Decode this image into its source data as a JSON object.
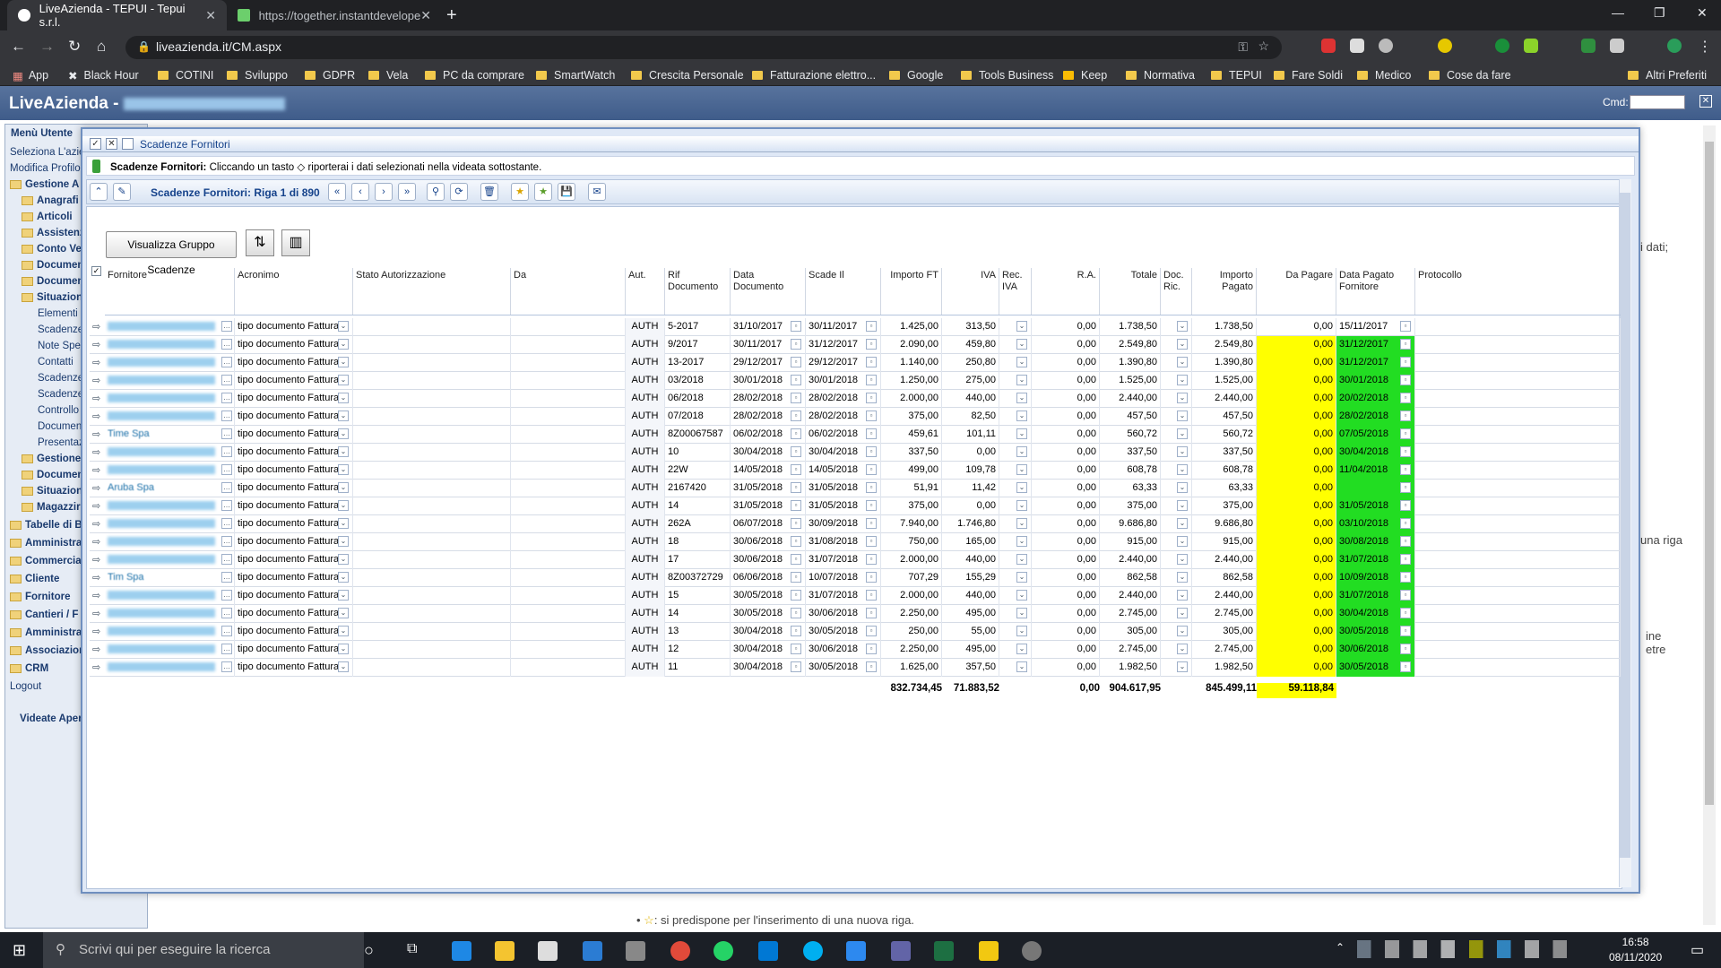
{
  "browser": {
    "tabs": [
      {
        "title": "LiveAzienda - TEPUI - Tepui s.r.l."
      },
      {
        "title": "https://together.instantdevelope"
      }
    ],
    "url": "liveazienda.it/CM.aspx",
    "bookmarks": [
      "App",
      "Black Hour",
      "COTINI",
      "Sviluppo",
      "GDPR",
      "Vela",
      "PC da comprare",
      "SmartWatch",
      "Crescita Personale",
      "Fatturazione elettro...",
      "Google",
      "Tools Business",
      "Keep",
      "Normativa",
      "TEPUI",
      "Fare Soldi",
      "Medico",
      "Cose da fare",
      "Altri Preferiti"
    ]
  },
  "app": {
    "title": "LiveAzienda -",
    "cmd_label": "Cmd:",
    "menu": {
      "header": "Menù Utente",
      "items": [
        "Seleziona L'azie",
        "Modifica Profilo",
        "Gestione A",
        "Anagrafi",
        "Articoli",
        "Assistenz",
        "Conto Ve",
        "Documen",
        "Documen",
        "Situazion",
        "Elementi",
        "Scadenze",
        "Note Spes",
        "Contatti",
        "Scadenze",
        "Scadenze",
        "Controllo",
        "Documen",
        "Presentaz",
        "Gestione",
        "Documen",
        "Situazion",
        "Magazzir",
        "Tabelle di B",
        "Amministra",
        "Commercial",
        "Cliente",
        "Fornitore",
        "Cantieri / F",
        "Amministra",
        "Associazion",
        "CRM",
        "Logout"
      ],
      "footer": "Videate Aper"
    },
    "bg_text": [
      "i dati;",
      "una riga",
      "ine",
      "etre",
      ": si predispone per l'inserimento di una nuova riga."
    ]
  },
  "dialog": {
    "title": "Scadenze Fornitori",
    "info_bold": "Scadenze Fornitori:",
    "info_text": "Cliccando un tasto",
    "info_text2": "riporterai i dati selezionati nella videata sottostante.",
    "nav_title": "Scadenze Fornitori: Riga 1 di 890",
    "group_button": "Visualizza Gruppo Scadenze",
    "columns": [
      "Fornitore",
      "Acronimo",
      "Stato Autorizzazione",
      "Da",
      "Aut.",
      "Rif Documento",
      "Data Documento",
      "Scade Il",
      "Importo FT",
      "IVA",
      "Rec. IVA",
      "R.A.",
      "Totale",
      "Doc. Ric.",
      "Importo Pagato",
      "Da Pagare",
      "Data Pagato Fornitore",
      "Protocollo"
    ],
    "rows": [
      {
        "acr": "tipo documento Fattura",
        "aut": "AUTH",
        "rif": "5-2017",
        "dd": "31/10/2017",
        "sc": "30/11/2017",
        "imp": "1.425,00",
        "iva": "313,50",
        "ra": "0,00",
        "tot": "1.738,50",
        "pag": "1.738,50",
        "dap": "0,00",
        "dpf": "15/11/2017",
        "hl": false
      },
      {
        "acr": "tipo documento Fattura",
        "aut": "AUTH",
        "rif": "9/2017",
        "dd": "30/11/2017",
        "sc": "31/12/2017",
        "imp": "2.090,00",
        "iva": "459,80",
        "ra": "0,00",
        "tot": "2.549,80",
        "pag": "2.549,80",
        "dap": "0,00",
        "dpf": "31/12/2017",
        "hl": true
      },
      {
        "acr": "tipo documento Fattura",
        "aut": "AUTH",
        "rif": "13-2017",
        "dd": "29/12/2017",
        "sc": "29/12/2017",
        "imp": "1.140,00",
        "iva": "250,80",
        "ra": "0,00",
        "tot": "1.390,80",
        "pag": "1.390,80",
        "dap": "0,00",
        "dpf": "31/12/2017",
        "hl": true
      },
      {
        "acr": "tipo documento Fattura",
        "aut": "AUTH",
        "rif": "03/2018",
        "dd": "30/01/2018",
        "sc": "30/01/2018",
        "imp": "1.250,00",
        "iva": "275,00",
        "ra": "0,00",
        "tot": "1.525,00",
        "pag": "1.525,00",
        "dap": "0,00",
        "dpf": "30/01/2018",
        "hl": true
      },
      {
        "acr": "tipo documento Fattura",
        "aut": "AUTH",
        "rif": "06/2018",
        "dd": "28/02/2018",
        "sc": "28/02/2018",
        "imp": "2.000,00",
        "iva": "440,00",
        "ra": "0,00",
        "tot": "2.440,00",
        "pag": "2.440,00",
        "dap": "0,00",
        "dpf": "20/02/2018",
        "hl": true
      },
      {
        "acr": "tipo documento Fattura",
        "aut": "AUTH",
        "rif": "07/2018",
        "dd": "28/02/2018",
        "sc": "28/02/2018",
        "imp": "375,00",
        "iva": "82,50",
        "ra": "0,00",
        "tot": "457,50",
        "pag": "457,50",
        "dap": "0,00",
        "dpf": "28/02/2018",
        "hl": true
      },
      {
        "acr": "tipo documento Fattura",
        "aut": "AUTH",
        "rif": "8Z00067587",
        "dd": "06/02/2018",
        "sc": "06/02/2018",
        "imp": "459,61",
        "iva": "101,11",
        "ra": "0,00",
        "tot": "560,72",
        "pag": "560,72",
        "dap": "0,00",
        "dpf": "07/05/2018",
        "hl": true
      },
      {
        "acr": "tipo documento Fattura",
        "aut": "AUTH",
        "rif": "10",
        "dd": "30/04/2018",
        "sc": "30/04/2018",
        "imp": "337,50",
        "iva": "0,00",
        "ra": "0,00",
        "tot": "337,50",
        "pag": "337,50",
        "dap": "0,00",
        "dpf": "30/04/2018",
        "hl": true
      },
      {
        "acr": "tipo documento Fattura",
        "aut": "AUTH",
        "rif": "22W",
        "dd": "14/05/2018",
        "sc": "14/05/2018",
        "imp": "499,00",
        "iva": "109,78",
        "ra": "0,00",
        "tot": "608,78",
        "pag": "608,78",
        "dap": "0,00",
        "dpf": "11/04/2018",
        "hl": true
      },
      {
        "acr": "tipo documento Fattura",
        "aut": "AUTH",
        "rif": "2167420",
        "dd": "31/05/2018",
        "sc": "31/05/2018",
        "imp": "51,91",
        "iva": "11,42",
        "ra": "0,00",
        "tot": "63,33",
        "pag": "63,33",
        "dap": "0,00",
        "dpf": "",
        "hl": true
      },
      {
        "acr": "tipo documento Fattura",
        "aut": "AUTH",
        "rif": "14",
        "dd": "31/05/2018",
        "sc": "31/05/2018",
        "imp": "375,00",
        "iva": "0,00",
        "ra": "0,00",
        "tot": "375,00",
        "pag": "375,00",
        "dap": "0,00",
        "dpf": "31/05/2018",
        "hl": true
      },
      {
        "acr": "tipo documento Fattura",
        "aut": "AUTH",
        "rif": "262A",
        "dd": "06/07/2018",
        "sc": "30/09/2018",
        "imp": "7.940,00",
        "iva": "1.746,80",
        "ra": "0,00",
        "tot": "9.686,80",
        "pag": "9.686,80",
        "dap": "0,00",
        "dpf": "03/10/2018",
        "hl": true
      },
      {
        "acr": "tipo documento Fattura",
        "aut": "AUTH",
        "rif": "18",
        "dd": "30/06/2018",
        "sc": "31/08/2018",
        "imp": "750,00",
        "iva": "165,00",
        "ra": "0,00",
        "tot": "915,00",
        "pag": "915,00",
        "dap": "0,00",
        "dpf": "30/08/2018",
        "hl": true
      },
      {
        "acr": "tipo documento Fattura",
        "aut": "AUTH",
        "rif": "17",
        "dd": "30/06/2018",
        "sc": "31/07/2018",
        "imp": "2.000,00",
        "iva": "440,00",
        "ra": "0,00",
        "tot": "2.440,00",
        "pag": "2.440,00",
        "dap": "0,00",
        "dpf": "31/07/2018",
        "hl": true
      },
      {
        "acr": "tipo documento Fattura",
        "aut": "AUTH",
        "rif": "8Z00372729",
        "dd": "06/06/2018",
        "sc": "10/07/2018",
        "imp": "707,29",
        "iva": "155,29",
        "ra": "0,00",
        "tot": "862,58",
        "pag": "862,58",
        "dap": "0,00",
        "dpf": "10/09/2018",
        "hl": true
      },
      {
        "acr": "tipo documento Fattura",
        "aut": "AUTH",
        "rif": "15",
        "dd": "30/05/2018",
        "sc": "31/07/2018",
        "imp": "2.000,00",
        "iva": "440,00",
        "ra": "0,00",
        "tot": "2.440,00",
        "pag": "2.440,00",
        "dap": "0,00",
        "dpf": "31/07/2018",
        "hl": true
      },
      {
        "acr": "tipo documento Fattura",
        "aut": "AUTH",
        "rif": "14",
        "dd": "30/05/2018",
        "sc": "30/06/2018",
        "imp": "2.250,00",
        "iva": "495,00",
        "ra": "0,00",
        "tot": "2.745,00",
        "pag": "2.745,00",
        "dap": "0,00",
        "dpf": "30/04/2018",
        "hl": true
      },
      {
        "acr": "tipo documento Fattura",
        "aut": "AUTH",
        "rif": "13",
        "dd": "30/04/2018",
        "sc": "30/05/2018",
        "imp": "250,00",
        "iva": "55,00",
        "ra": "0,00",
        "tot": "305,00",
        "pag": "305,00",
        "dap": "0,00",
        "dpf": "30/05/2018",
        "hl": true
      },
      {
        "acr": "tipo documento Fattura",
        "aut": "AUTH",
        "rif": "12",
        "dd": "30/04/2018",
        "sc": "30/06/2018",
        "imp": "2.250,00",
        "iva": "495,00",
        "ra": "0,00",
        "tot": "2.745,00",
        "pag": "2.745,00",
        "dap": "0,00",
        "dpf": "30/06/2018",
        "hl": true
      },
      {
        "acr": "tipo documento Fattura",
        "aut": "AUTH",
        "rif": "11",
        "dd": "30/04/2018",
        "sc": "30/05/2018",
        "imp": "1.625,00",
        "iva": "357,50",
        "ra": "0,00",
        "tot": "1.982,50",
        "pag": "1.982,50",
        "dap": "0,00",
        "dpf": "30/05/2018",
        "hl": true
      }
    ],
    "named_rows": [
      "Time Spa",
      "Aruba Spa",
      "Tim Spa"
    ],
    "totals": {
      "imp": "832.734,45",
      "iva": "71.883,52",
      "ra": "0,00",
      "tot": "904.617,95",
      "pag": "845.499,11",
      "dap": "59.118,84"
    }
  },
  "taskbar": {
    "search_placeholder": "Scrivi qui per eseguire la ricerca",
    "time": "16:58",
    "date": "08/11/2020"
  },
  "colors": {
    "highlight_yellow": "#ffff00",
    "highlight_green": "#22dd22",
    "header_blue": "#3f5c8a"
  }
}
